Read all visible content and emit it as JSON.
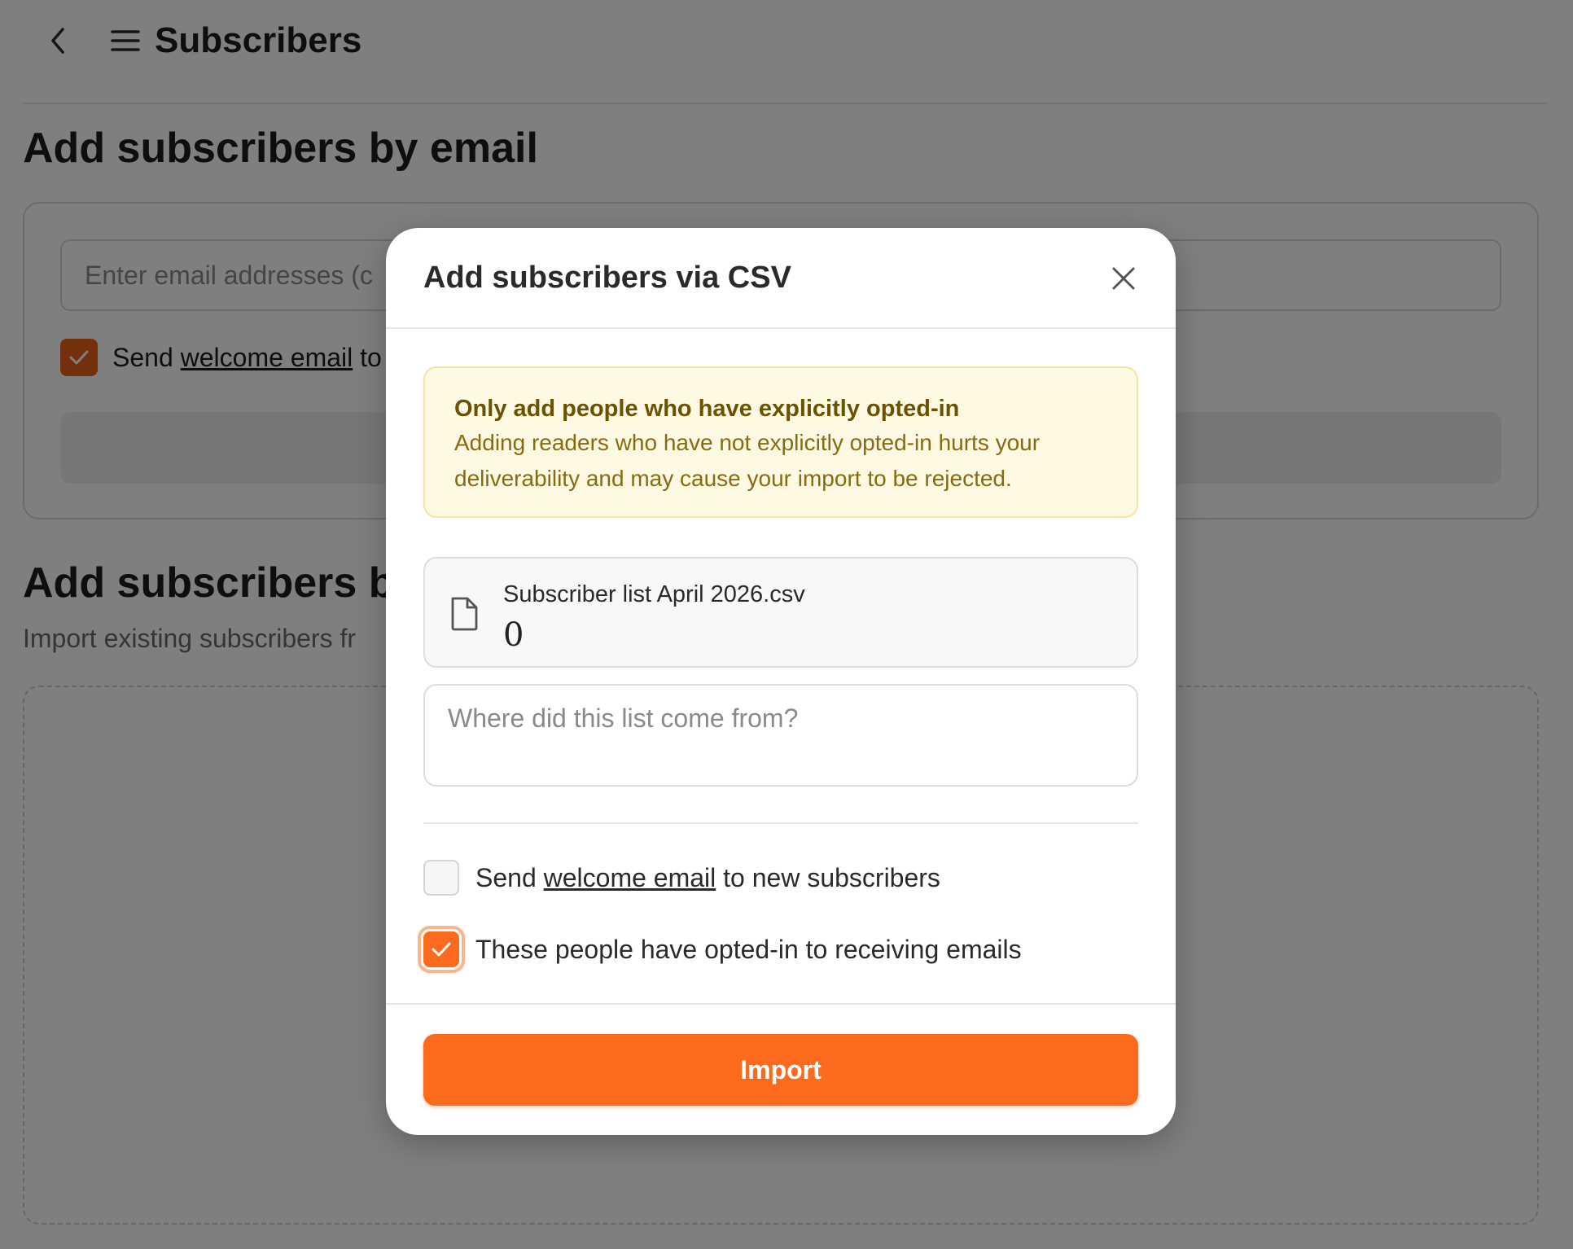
{
  "topbar": {
    "title": "Subscribers",
    "back_icon": "chevron-left-icon",
    "menu_icon": "hamburger-menu-icon"
  },
  "email_section": {
    "title": "Add subscribers by email",
    "input_placeholder": "Enter email addresses (c",
    "welcome_prefix": "Send ",
    "welcome_link": "welcome email",
    "welcome_suffix": " to",
    "welcome_checked": true
  },
  "csv_section": {
    "title": "Add subscribers b",
    "subtitle": "Import existing subscribers fr"
  },
  "modal": {
    "title": "Add subscribers via CSV",
    "close_icon": "close-icon",
    "warning": {
      "title": "Only add people who have explicitly opted-in",
      "body": "Adding readers who have not explicitly opted-in hurts your deliverability and may cause your import to be rejected."
    },
    "file": {
      "icon": "file-icon",
      "name": "Subscriber list April 2026.csv",
      "count": "0"
    },
    "source_placeholder": "Where did this list come from?",
    "welcome_checkbox": {
      "prefix": "Send ",
      "link": "welcome email",
      "suffix": " to new subscribers",
      "checked": false
    },
    "optin_checkbox": {
      "label": "These people have opted-in to receiving emails",
      "checked": true
    },
    "import_label": "Import"
  },
  "colors": {
    "accent": "#fc6a1e",
    "warning_bg": "#fef9e3",
    "warning_text": "#8a6a10",
    "overlay": "rgba(0,0,0,0.5)"
  }
}
